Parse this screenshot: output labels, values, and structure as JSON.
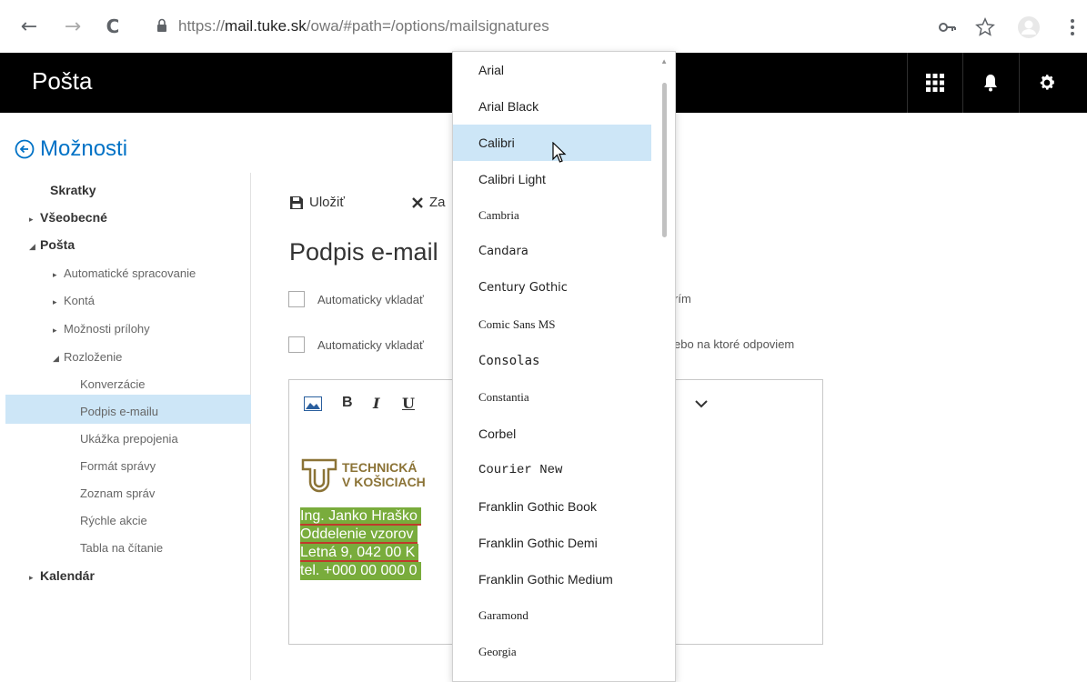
{
  "browser": {
    "back_icon": "←",
    "forward_icon": "→",
    "reload_icon": "C",
    "url_prefix": "https://",
    "url_host": "mail.tuke.sk",
    "url_path": "/owa/#path=/options/mailsignatures"
  },
  "app": {
    "title": "Pošta"
  },
  "nav": {
    "options_title": "Možnosti",
    "shortcuts": "Skratky",
    "general": "Všeobecné",
    "mail": "Pošta",
    "auto_processing": "Automatické spracovanie",
    "accounts": "Kontá",
    "attachment_options": "Možnosti prílohy",
    "layout": "Rozloženie",
    "conversations": "Konverzácie",
    "email_signature": "Podpis e-mailu",
    "link_preview": "Ukážka prepojenia",
    "message_format": "Formát správy",
    "message_list": "Zoznam správ",
    "quick_actions": "Rýchle akcie",
    "reading_pane": "Tabla na čítanie",
    "calendar": "Kalendár"
  },
  "toolbar": {
    "save_label": "Uložiť",
    "discard_label": "Za"
  },
  "main": {
    "page_title": "Podpis e-mail",
    "checkbox1_label": "Automaticky vkladať",
    "checkbox1_tail": "rím",
    "checkbox2_label": "Automaticky vkladať",
    "checkbox2_tail": "ebo na ktoré odpoviem"
  },
  "editor": {
    "bold": "B",
    "italic": "I",
    "underline": "U",
    "logo_line1": "TECHNICKÁ",
    "logo_line2": "V KOŠICIACH",
    "signature_lines": [
      "Ing. Janko Hraško",
      "Oddelenie vzorov",
      "Letná 9, 042 00 K",
      "tel. +000 00 000 0"
    ]
  },
  "font_dropdown": {
    "items": [
      "Arial",
      "Arial Black",
      "Calibri",
      "Calibri Light",
      "Cambria",
      "Candara",
      "Century Gothic",
      "Comic Sans MS",
      "Consolas",
      "Constantia",
      "Corbel",
      "Courier New",
      "Franklin Gothic Book",
      "Franklin Gothic Demi",
      "Franklin Gothic Medium",
      "Garamond",
      "Georgia"
    ],
    "hovered": "Calibri"
  },
  "colors": {
    "accent": "#0072c6",
    "header_bg": "#000000",
    "selected_bg": "#cde6f7",
    "signature_bg": "#79ac3c",
    "logo_color": "#8b7336"
  }
}
